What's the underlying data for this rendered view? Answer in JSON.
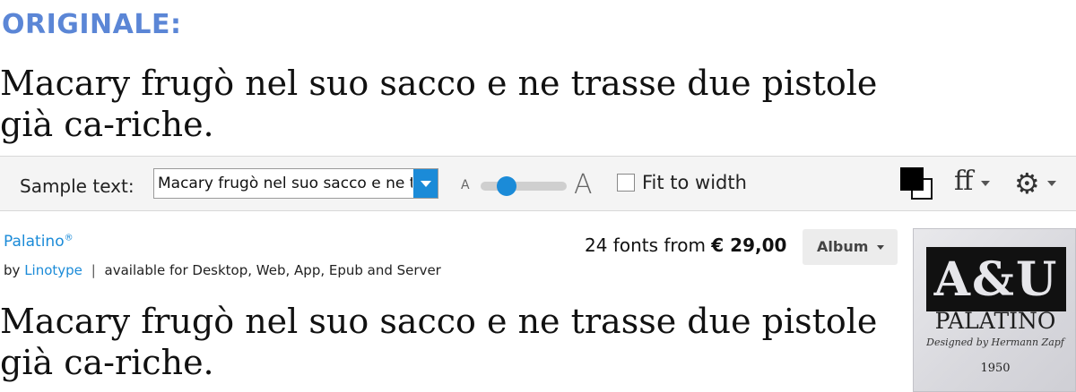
{
  "heading": "ORIGINALE:",
  "original_text": "Macary frugò nel suo sacco e ne trasse due pistole già ca-riche.",
  "toolbar": {
    "sample_label": "Sample text:",
    "sample_value": "Macary frugò nel suo sacco e ne trasse due pistole già cariche.",
    "size_small": "A",
    "size_large": "A",
    "slider_level": 0.3,
    "fit_label": "Fit to width",
    "fit_checked": false,
    "ff_label": "ff",
    "accent_color": "#1b8bd8"
  },
  "font": {
    "name": "Palatino",
    "trademark": "®",
    "by": "by",
    "foundry": "Linotype",
    "separator": "|",
    "availability": "available for Desktop, Web, App, Epub and Server",
    "fonts_count": "24 fonts from",
    "price": "€ 29,00",
    "album_label": "Album",
    "preview_text": "Macary frugò nel suo sacco e ne trasse due pistole già ca-riche."
  },
  "thumbnail": {
    "glyphs": "A&U",
    "title": "PALATINO",
    "subtitle": "Designed by Hermann Zapf",
    "year": "1950"
  }
}
